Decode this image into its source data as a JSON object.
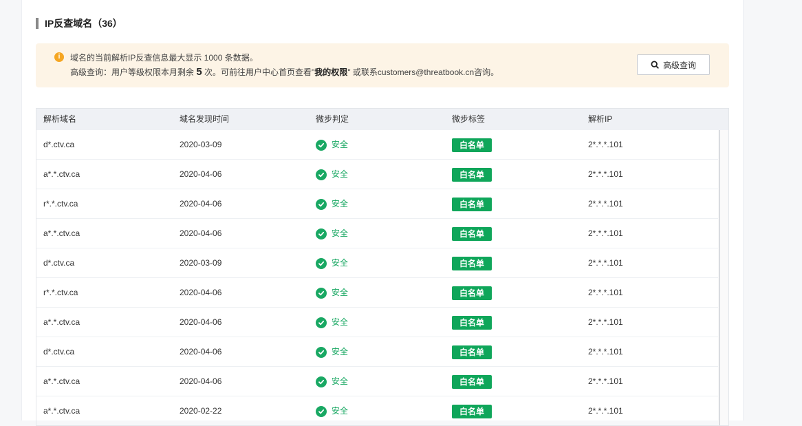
{
  "section": {
    "title": "IP反查域名（36）"
  },
  "notice": {
    "line1": "域名的当前解析IP反查信息最大显示 1000 条数据。",
    "line2_prefix": "高级查询：用户等级权限本月剩余 ",
    "line2_count": "5",
    "line2_middle": " 次。可前往用户中心首页查看\"",
    "line2_link": "我的权限",
    "line2_suffix": "\" 或联系customers@threatbook.cn咨询。",
    "button_label": "高级查询"
  },
  "table": {
    "headers": [
      "解析域名",
      "域名发现时间",
      "微步判定",
      "微步标签",
      "解析IP"
    ],
    "rows": [
      {
        "domain": "d*.ctv.ca",
        "date": "2020-03-09",
        "verdict": "安全",
        "tag": "白名单",
        "ip": "2*.*.*.101"
      },
      {
        "domain": "a*.*.ctv.ca",
        "date": "2020-04-06",
        "verdict": "安全",
        "tag": "白名单",
        "ip": "2*.*.*.101"
      },
      {
        "domain": "r*.*.ctv.ca",
        "date": "2020-04-06",
        "verdict": "安全",
        "tag": "白名单",
        "ip": "2*.*.*.101"
      },
      {
        "domain": "a*.*.ctv.ca",
        "date": "2020-04-06",
        "verdict": "安全",
        "tag": "白名单",
        "ip": "2*.*.*.101"
      },
      {
        "domain": "d*.ctv.ca",
        "date": "2020-03-09",
        "verdict": "安全",
        "tag": "白名单",
        "ip": "2*.*.*.101"
      },
      {
        "domain": "r*.*.ctv.ca",
        "date": "2020-04-06",
        "verdict": "安全",
        "tag": "白名单",
        "ip": "2*.*.*.101"
      },
      {
        "domain": "a*.*.ctv.ca",
        "date": "2020-04-06",
        "verdict": "安全",
        "tag": "白名单",
        "ip": "2*.*.*.101"
      },
      {
        "domain": "d*.ctv.ca",
        "date": "2020-04-06",
        "verdict": "安全",
        "tag": "白名单",
        "ip": "2*.*.*.101"
      },
      {
        "domain": "a*.*.ctv.ca",
        "date": "2020-04-06",
        "verdict": "安全",
        "tag": "白名单",
        "ip": "2*.*.*.101"
      },
      {
        "domain": "a*.*.ctv.ca",
        "date": "2020-02-22",
        "verdict": "安全",
        "tag": "白名单",
        "ip": "2*.*.*.101"
      }
    ]
  },
  "colors": {
    "safe": "#19a863",
    "tag_bg": "#0fa65a",
    "notice_bg": "#fdf4e6",
    "info_icon": "#f5a623",
    "header_bg": "#eff1f5"
  },
  "icons": {
    "info": "info-icon",
    "search": "search-icon",
    "safe": "check-circle-icon"
  }
}
